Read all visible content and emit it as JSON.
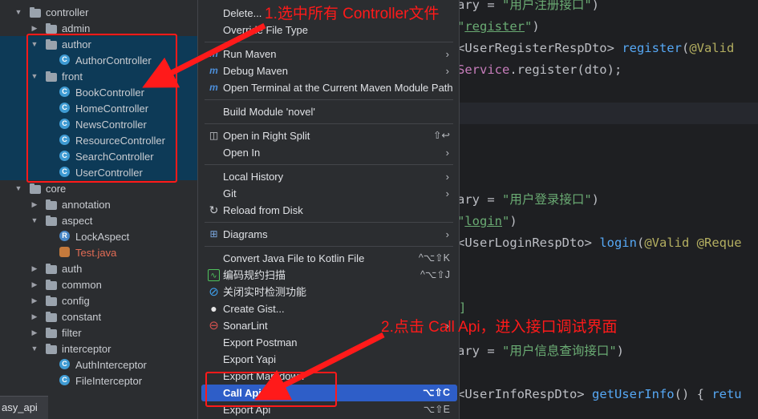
{
  "editor": {
    "lines": [
      {
        "parts": [
          {
            "c": "plain",
            "t": "ary = "
          },
          {
            "c": "str",
            "t": "\"用户注册接口\""
          },
          {
            "c": "plain",
            "t": ")"
          }
        ]
      },
      {
        "parts": [
          {
            "c": "str",
            "t": "\""
          },
          {
            "c": "str-u",
            "t": "register"
          },
          {
            "c": "str",
            "t": "\""
          },
          {
            "c": "plain",
            "t": ")"
          }
        ]
      },
      {
        "parts": [
          {
            "c": "plain",
            "t": "<UserRegisterRespDto> "
          },
          {
            "c": "fn",
            "t": "register"
          },
          {
            "c": "plain",
            "t": "("
          },
          {
            "c": "ann",
            "t": "@Valid"
          }
        ]
      },
      {
        "parts": [
          {
            "c": "fld",
            "t": "Service"
          },
          {
            "c": "plain",
            "t": ".register(dto);"
          }
        ]
      },
      {
        "parts": [
          {
            "c": "plain",
            "t": "ary = "
          },
          {
            "c": "str",
            "t": "\"用户登录接口\""
          },
          {
            "c": "plain",
            "t": ")"
          }
        ]
      },
      {
        "parts": [
          {
            "c": "str",
            "t": "\""
          },
          {
            "c": "str-u",
            "t": "login"
          },
          {
            "c": "str",
            "t": "\""
          },
          {
            "c": "plain",
            "t": ")"
          }
        ]
      },
      {
        "parts": [
          {
            "c": "plain",
            "t": "<UserLoginRespDto> "
          },
          {
            "c": "fn",
            "t": "login"
          },
          {
            "c": "plain",
            "t": "("
          },
          {
            "c": "ann",
            "t": "@Valid @Reque"
          }
        ]
      },
      {
        "parts": [
          {
            "c": "str",
            "t": "]"
          }
        ]
      },
      {
        "parts": [
          {
            "c": "plain",
            "t": "ary = "
          },
          {
            "c": "str",
            "t": "\"用户信息查询接口\""
          },
          {
            "c": "plain",
            "t": ")"
          }
        ]
      },
      {
        "parts": [
          {
            "c": "plain",
            "t": "<UserInfoRespDto> "
          },
          {
            "c": "fn",
            "t": "getUserInfo"
          },
          {
            "c": "plain",
            "t": "() { "
          },
          {
            "c": "fn",
            "t": "retu"
          }
        ]
      }
    ]
  },
  "tree": {
    "items": [
      {
        "name": "controller",
        "type": "folder",
        "expanded": true
      },
      {
        "name": "admin",
        "type": "folder",
        "expanded": false
      },
      {
        "name": "author",
        "type": "folder",
        "expanded": true
      },
      {
        "name": "AuthorController",
        "type": "class"
      },
      {
        "name": "front",
        "type": "folder",
        "expanded": true
      },
      {
        "name": "BookController",
        "type": "class"
      },
      {
        "name": "HomeController",
        "type": "class"
      },
      {
        "name": "NewsController",
        "type": "class"
      },
      {
        "name": "ResourceController",
        "type": "class"
      },
      {
        "name": "SearchController",
        "type": "class"
      },
      {
        "name": "UserController",
        "type": "class"
      },
      {
        "name": "core",
        "type": "folder",
        "expanded": true
      },
      {
        "name": "annotation",
        "type": "folder",
        "expanded": false
      },
      {
        "name": "aspect",
        "type": "folder",
        "expanded": true
      },
      {
        "name": "LockAspect",
        "type": "class",
        "icon_letter": "R"
      },
      {
        "name": "Test.java",
        "type": "java"
      },
      {
        "name": "auth",
        "type": "folder",
        "expanded": false
      },
      {
        "name": "common",
        "type": "folder",
        "expanded": false
      },
      {
        "name": "config",
        "type": "folder",
        "expanded": false
      },
      {
        "name": "constant",
        "type": "folder",
        "expanded": false
      },
      {
        "name": "filter",
        "type": "folder",
        "expanded": false
      },
      {
        "name": "interceptor",
        "type": "folder",
        "expanded": true
      },
      {
        "name": "AuthInterceptor",
        "type": "class"
      },
      {
        "name": "FileInterceptor",
        "type": "class"
      }
    ]
  },
  "bottom_tab": {
    "label": "asy_api"
  },
  "menu": {
    "items": [
      {
        "label": "Delete...",
        "shortcut": "",
        "submenu": false,
        "icon": ""
      },
      {
        "label": "Override File Type",
        "shortcut": "",
        "submenu": false,
        "icon": ""
      },
      {
        "sep": true
      },
      {
        "label": "Run Maven",
        "shortcut": "",
        "submenu": true,
        "icon": "m"
      },
      {
        "label": "Debug Maven",
        "shortcut": "",
        "submenu": true,
        "icon": "m"
      },
      {
        "label": "Open Terminal at the Current Maven Module Path",
        "shortcut": "",
        "submenu": false,
        "icon": "m"
      },
      {
        "sep": true
      },
      {
        "label": "Build Module 'novel'",
        "shortcut": "",
        "submenu": false,
        "icon": ""
      },
      {
        "sep": true
      },
      {
        "label": "Open in Right Split",
        "shortcut": "⇧↩",
        "submenu": false,
        "icon": "split"
      },
      {
        "label": "Open In",
        "shortcut": "",
        "submenu": true,
        "icon": ""
      },
      {
        "sep": true
      },
      {
        "label": "Local History",
        "shortcut": "",
        "submenu": true,
        "icon": ""
      },
      {
        "label": "Git",
        "shortcut": "",
        "submenu": true,
        "icon": ""
      },
      {
        "label": "Reload from Disk",
        "shortcut": "",
        "submenu": false,
        "icon": "reload"
      },
      {
        "sep": true
      },
      {
        "label": "Diagrams",
        "shortcut": "",
        "submenu": true,
        "icon": "diagram"
      },
      {
        "sep": true
      },
      {
        "label": "Convert Java File to Kotlin File",
        "shortcut": "^⌥⇧K",
        "submenu": false,
        "icon": ""
      },
      {
        "label": "编码规约扫描",
        "shortcut": "^⌥⇧J",
        "submenu": false,
        "icon": "scan"
      },
      {
        "label": "关闭实时检测功能",
        "shortcut": "",
        "submenu": false,
        "icon": "block"
      },
      {
        "label": "Create Gist...",
        "shortcut": "",
        "submenu": false,
        "icon": "github"
      },
      {
        "label": "SonarLint",
        "shortcut": "",
        "submenu": true,
        "icon": "sonar"
      },
      {
        "label": "Export Postman",
        "shortcut": "",
        "submenu": false,
        "icon": ""
      },
      {
        "label": "Export Yapi",
        "shortcut": "",
        "submenu": false,
        "icon": ""
      },
      {
        "label": "Export Markdown",
        "shortcut": "",
        "submenu": false,
        "icon": ""
      },
      {
        "label": "Call Api",
        "shortcut": "⌥⇧C",
        "submenu": false,
        "icon": "",
        "active": true
      },
      {
        "label": "Export Api",
        "shortcut": "⌥⇧E",
        "submenu": false,
        "icon": ""
      }
    ]
  },
  "annotations": {
    "step1": "1.选中所有 Controller文件",
    "step2": "2.点击 Call Api，进入接口调试界面",
    "color": "#ff1a1a"
  }
}
